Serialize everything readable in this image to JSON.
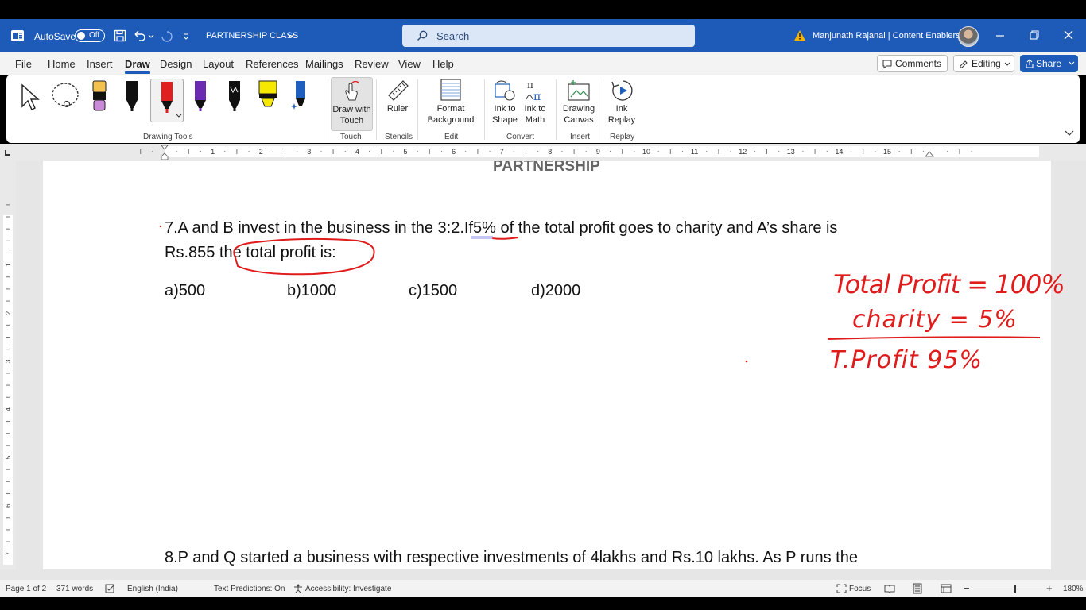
{
  "titlebar": {
    "autosave_label": "AutoSave",
    "autosave_state": "Off",
    "doc_title": "PARTNERSHIP CLASS",
    "search_placeholder": "Search",
    "user_name": "Manjunath Rajanal | Content Enablers"
  },
  "menu": {
    "tabs": [
      "File",
      "Home",
      "Insert",
      "Draw",
      "Design",
      "Layout",
      "References",
      "Mailings",
      "Review",
      "View",
      "Help"
    ],
    "active_tab": "Draw",
    "comments_label": "Comments",
    "editing_label": "Editing",
    "share_label": "Share"
  },
  "ribbon": {
    "groups": {
      "drawing_tools": "Drawing Tools",
      "touch": "Touch",
      "stencils": "Stencils",
      "edit": "Edit",
      "convert": "Convert",
      "insert": "Insert",
      "replay": "Replay"
    },
    "buttons": {
      "draw_with_touch_1": "Draw with",
      "draw_with_touch_2": "Touch",
      "ruler": "Ruler",
      "format_background_1": "Format",
      "format_background_2": "Background",
      "ink_to_shape_1": "Ink to",
      "ink_to_shape_2": "Shape",
      "ink_to_math_1": "Ink to",
      "ink_to_math_2": "Math",
      "drawing_canvas_1": "Drawing",
      "drawing_canvas_2": "Canvas",
      "ink_replay_1": "Ink",
      "ink_replay_2": "Replay"
    },
    "pen_colors": [
      "#000000",
      "#e02020",
      "#6a2bb0",
      "#111111",
      "#f6e800",
      "#1f5fbf"
    ]
  },
  "ruler": {
    "numbers": [
      "1",
      "2",
      "3",
      "4",
      "5",
      "6",
      "7",
      "8",
      "9",
      "10",
      "11",
      "12",
      "13",
      "14",
      "15"
    ],
    "vnumbers": [
      "1",
      "2",
      "3",
      "4",
      "5",
      "6",
      "7"
    ]
  },
  "document": {
    "heading": "PARTNERSHIP",
    "q7_line1": "7.A and B invest in the business in the 3:2.If5% of the total profit goes to charity and A’s share is",
    "q7_line2": "Rs.855 the total profit is:",
    "options": [
      "a)500",
      "b)1000",
      "c)1500",
      "d)2000"
    ],
    "q8_line1": "8.P and Q started a business with respective investments of 4lakhs and Rs.10 lakhs. As P runs the"
  },
  "ink": {
    "color": "#e01b1b",
    "line1": "Total Profit = 100%",
    "line2": "charity = 5%",
    "line3": "T.Profit 95%"
  },
  "statusbar": {
    "page": "Page 1 of 2",
    "words": "371 words",
    "language": "English (India)",
    "text_predictions": "Text Predictions: On",
    "accessibility": "Accessibility: Investigate",
    "focus": "Focus",
    "zoom": "180%"
  }
}
